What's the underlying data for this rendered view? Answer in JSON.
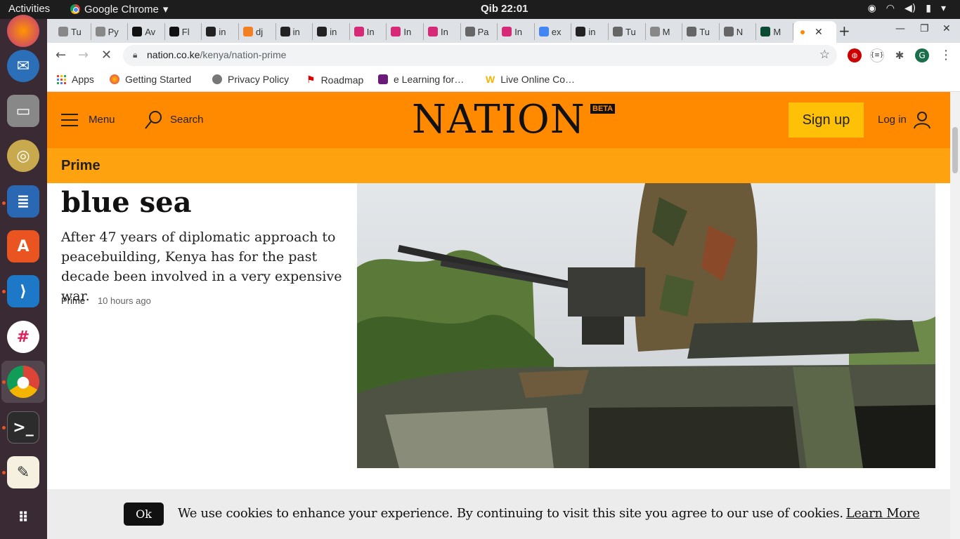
{
  "system": {
    "activities": "Activities",
    "app_name": "Google Chrome",
    "clock": "Qib 22:01"
  },
  "tabs": [
    {
      "label": "Tu",
      "color": "#888"
    },
    {
      "label": "Py",
      "color": "#888"
    },
    {
      "label": "Av",
      "color": "#111"
    },
    {
      "label": "Fl",
      "color": "#111"
    },
    {
      "label": "in",
      "color": "#222"
    },
    {
      "label": "dj",
      "color": "#f48024"
    },
    {
      "label": "in",
      "color": "#222"
    },
    {
      "label": "in",
      "color": "#222"
    },
    {
      "label": "In",
      "color": "#d62976"
    },
    {
      "label": "In",
      "color": "#d62976"
    },
    {
      "label": "In",
      "color": "#d62976"
    },
    {
      "label": "Pa",
      "color": "#666"
    },
    {
      "label": "In",
      "color": "#d62976"
    },
    {
      "label": "ex",
      "color": "#4285f4"
    },
    {
      "label": "in",
      "color": "#222"
    },
    {
      "label": "Tu",
      "color": "#666"
    },
    {
      "label": "M",
      "color": "#888"
    },
    {
      "label": "Tu",
      "color": "#666"
    },
    {
      "label": "N",
      "color": "#666"
    },
    {
      "label": "M",
      "color": "#0c4b33"
    }
  ],
  "active_tab": {
    "label": "",
    "close": "✕"
  },
  "address": {
    "domain": "nation.co.ke",
    "path": "/kenya/nation-prime"
  },
  "profile_initial": "G",
  "bookmarks": [
    {
      "label": "Apps"
    },
    {
      "label": "Getting Started"
    },
    {
      "label": "Privacy Policy"
    },
    {
      "label": "Roadmap"
    },
    {
      "label": "e Learning for…"
    },
    {
      "label": "Live Online Co…"
    }
  ],
  "site": {
    "menu_label": "Menu",
    "search_label": "Search",
    "logo": "NATION",
    "beta": "BETA",
    "signup": "Sign up",
    "login": "Log in",
    "section": "Prime"
  },
  "article": {
    "headline": "blue sea",
    "summary": "After 47 years of diplomatic approach to peacebuilding, Kenya has for the past decade been involved in a very expensive war.",
    "tag": "Prime",
    "time": "10 hours ago"
  },
  "cookie": {
    "ok": "Ok",
    "message": "We use cookies to enhance your experience. By continuing to visit this site you agree to our use of cookies.",
    "learn_more": "Learn More"
  }
}
